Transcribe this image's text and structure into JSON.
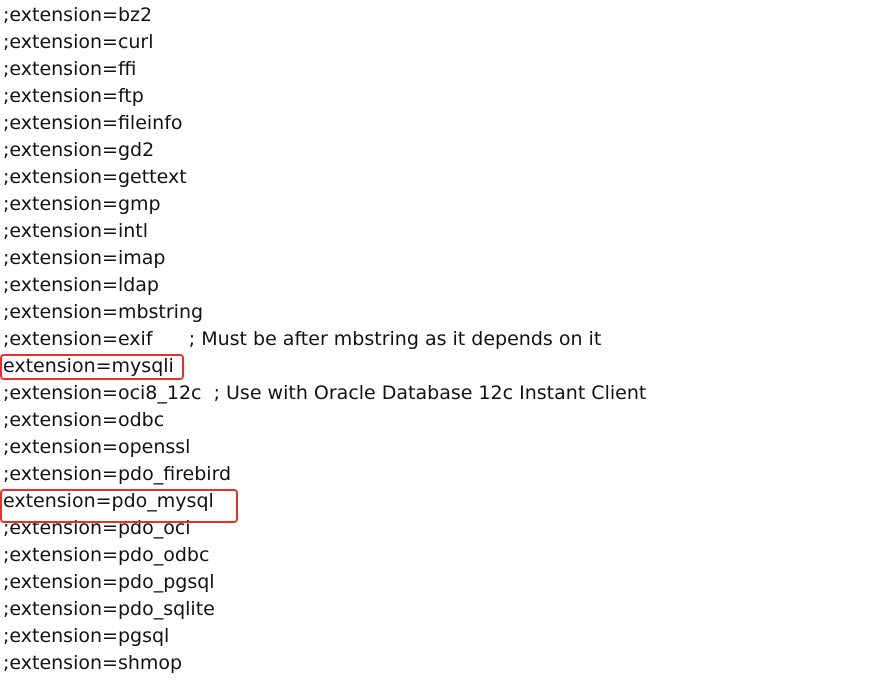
{
  "lines": [
    ";extension=bz2",
    ";extension=curl",
    ";extension=ffi",
    ";extension=ftp",
    ";extension=fileinfo",
    ";extension=gd2",
    ";extension=gettext",
    ";extension=gmp",
    ";extension=intl",
    ";extension=imap",
    ";extension=ldap",
    ";extension=mbstring",
    ";extension=exif      ; Must be after mbstring as it depends on it",
    "extension=mysqli",
    ";extension=oci8_12c  ; Use with Oracle Database 12c Instant Client",
    ";extension=odbc",
    ";extension=openssl",
    ";extension=pdo_firebird",
    "extension=pdo_mysql",
    ";extension=pdo_oci",
    ";extension=pdo_odbc",
    ";extension=pdo_pgsql",
    ";extension=pdo_sqlite",
    ";extension=pgsql",
    ";extension=shmop"
  ],
  "highlight_color": "#e8302a"
}
